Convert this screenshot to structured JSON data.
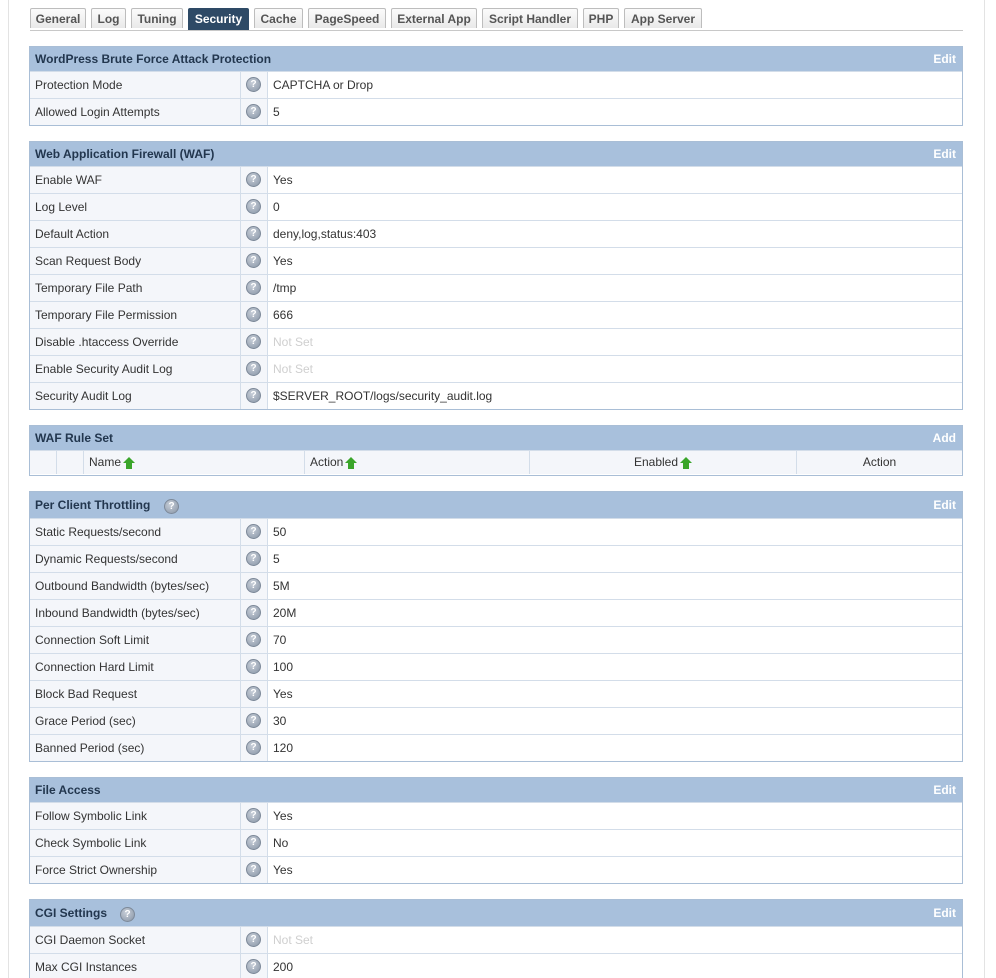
{
  "tabs": [
    {
      "label": "General"
    },
    {
      "label": "Log"
    },
    {
      "label": "Tuning"
    },
    {
      "label": "Security",
      "active": true
    },
    {
      "label": "Cache"
    },
    {
      "label": "PageSpeed"
    },
    {
      "label": "External App"
    },
    {
      "label": "Script Handler"
    },
    {
      "label": "PHP"
    },
    {
      "label": "App Server"
    }
  ],
  "help_glyph": "?",
  "brute_force": {
    "title": "WordPress Brute Force Attack Protection",
    "action": "Edit",
    "rows": [
      {
        "label": "Protection Mode",
        "value": "CAPTCHA or Drop"
      },
      {
        "label": "Allowed Login Attempts",
        "value": "5"
      }
    ]
  },
  "waf": {
    "title": "Web Application Firewall (WAF)",
    "action": "Edit",
    "rows": [
      {
        "label": "Enable WAF",
        "value": "Yes"
      },
      {
        "label": "Log Level",
        "value": "0"
      },
      {
        "label": "Default Action",
        "value": "deny,log,status:403"
      },
      {
        "label": "Scan Request Body",
        "value": "Yes"
      },
      {
        "label": "Temporary File Path",
        "value": "/tmp"
      },
      {
        "label": "Temporary File Permission",
        "value": "666"
      },
      {
        "label": "Disable .htaccess Override",
        "value": "Not Set"
      },
      {
        "label": "Enable Security Audit Log",
        "value": "Not Set"
      },
      {
        "label": "Security Audit Log",
        "value": "$SERVER_ROOT/logs/security_audit.log"
      }
    ]
  },
  "waf_ruleset": {
    "title": "WAF Rule Set",
    "action": "Add",
    "columns": {
      "name": "Name",
      "action": "Action",
      "enabled": "Enabled",
      "actions": "Action"
    }
  },
  "throttling": {
    "title": "Per Client Throttling",
    "action": "Edit",
    "rows": [
      {
        "label": "Static Requests/second",
        "value": "50"
      },
      {
        "label": "Dynamic Requests/second",
        "value": "5"
      },
      {
        "label": "Outbound Bandwidth (bytes/sec)",
        "value": "5M"
      },
      {
        "label": "Inbound Bandwidth (bytes/sec)",
        "value": "20M"
      },
      {
        "label": "Connection Soft Limit",
        "value": "70"
      },
      {
        "label": "Connection Hard Limit",
        "value": "100"
      },
      {
        "label": "Block Bad Request",
        "value": "Yes"
      },
      {
        "label": "Grace Period (sec)",
        "value": "30"
      },
      {
        "label": "Banned Period (sec)",
        "value": "120"
      }
    ]
  },
  "file_access": {
    "title": "File Access",
    "action": "Edit",
    "rows": [
      {
        "label": "Follow Symbolic Link",
        "value": "Yes"
      },
      {
        "label": "Check Symbolic Link",
        "value": "No"
      },
      {
        "label": "Force Strict Ownership",
        "value": "Yes"
      }
    ]
  },
  "cgi": {
    "title": "CGI Settings",
    "action": "Edit",
    "rows": [
      {
        "label": "CGI Daemon Socket",
        "value": "Not Set"
      },
      {
        "label": "Max CGI Instances",
        "value": "200"
      }
    ]
  }
}
